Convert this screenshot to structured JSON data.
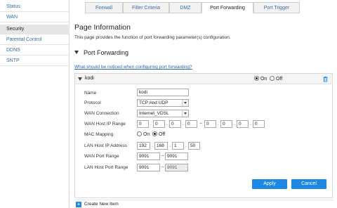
{
  "sidebar": {
    "items": [
      {
        "label": "Status"
      },
      {
        "label": "WAN"
      },
      {
        "label": "Security",
        "active": true
      },
      {
        "label": "Parental Control"
      },
      {
        "label": "DDNS"
      },
      {
        "label": "SNTP"
      }
    ]
  },
  "tabs": [
    {
      "label": "Firewall"
    },
    {
      "label": "Filter Criteria"
    },
    {
      "label": "DMZ"
    },
    {
      "label": "Port Forwarding",
      "active": true
    },
    {
      "label": "Port Trigger"
    }
  ],
  "page": {
    "title": "Page Information",
    "description": "This page provides the function of port forwarding parameter(s) configuration.",
    "section": "Port Forwarding",
    "help_link": "What should be noticed when configuring port forwarding?"
  },
  "entry": {
    "name": "kodi",
    "on_label": "On",
    "off_label": "Off",
    "enabled": "On"
  },
  "form": {
    "name_label": "Name",
    "name_value": "kodi",
    "protocol_label": "Protocol",
    "protocol_value": "TCP And UDP",
    "wan_conn_label": "WAN Connection",
    "wan_conn_value": "Internet_VDSL",
    "wan_ip_label": "WAN Host IP Range",
    "wan_ip_start": [
      "0",
      "0",
      "0",
      "0"
    ],
    "wan_ip_end": [
      "0",
      "0",
      "0",
      "0"
    ],
    "mac_label": "MAC Mapping",
    "mac_on": "On",
    "mac_off": "Off",
    "mac_selected": "Off",
    "lan_ip_label": "LAN Host IP Address",
    "lan_ip": [
      "192",
      "168",
      "1",
      "50"
    ],
    "wan_port_label": "WAN Port Range",
    "wan_port_start": "9091",
    "wan_port_end": "9091",
    "lan_port_label": "LAN Host Port Range",
    "lan_port_start": "9091",
    "lan_port_end": "9091",
    "dot": ".",
    "tilde": "~",
    "dash": "–"
  },
  "buttons": {
    "apply": "Apply",
    "cancel": "Cancel"
  },
  "create": {
    "label": "Create New Item"
  },
  "colors": {
    "accent": "#1e88e5",
    "link": "#3a6ea5"
  },
  "icons": {
    "trash": "trash-icon",
    "plus": "plus-icon",
    "collapse": "triangle-down-icon"
  }
}
